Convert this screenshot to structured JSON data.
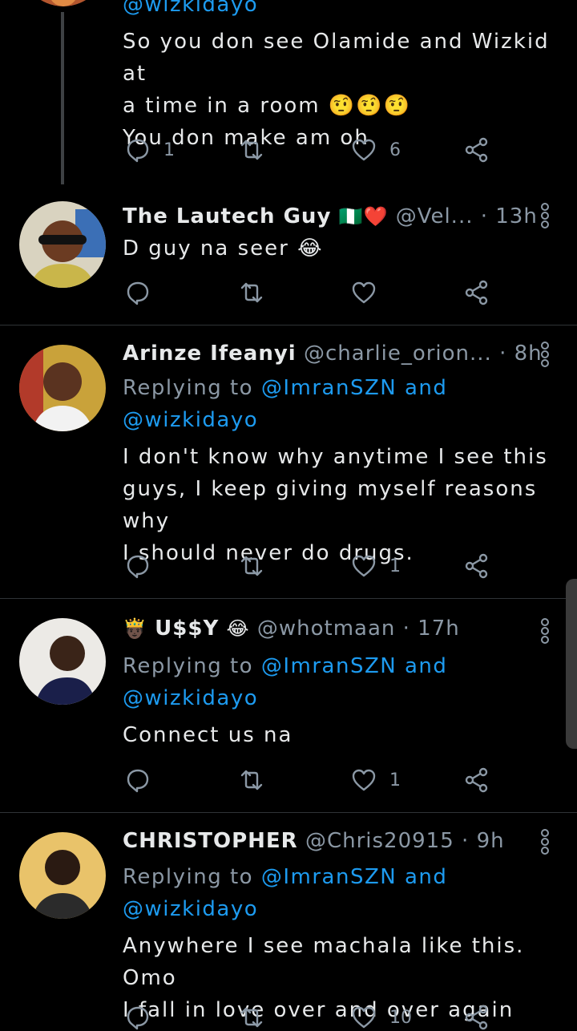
{
  "tweets": [
    {
      "mention_top": "@wizkidayo",
      "text_lines": [
        "So you don see Olamide and Wizkid at",
        "a time in a room 🤨🤨🤨",
        "You don make am oh"
      ],
      "reply_count": "1",
      "like_count": "6"
    },
    {
      "name": "The Lautech Guy",
      "name_emoji": "🇳🇬❤️",
      "handle": "@Vel...",
      "time": "· 13h",
      "text_lines": [
        "D guy na seer 😂"
      ]
    },
    {
      "name": "Arinze Ifeanyi",
      "handle": "@charlie_orion...",
      "time": "· 8h",
      "replying_prefix": "Replying to",
      "mention1": "@ImranSZN and",
      "mention2": "@wizkidayo",
      "text_lines": [
        "I don't know why anytime I see this",
        "guys, I keep giving myself reasons why",
        "I should never do drugs."
      ],
      "like_count": "1"
    },
    {
      "name_prefix_emoji": "🤴🏿",
      "name": "U$$Y",
      "name_emoji": "😂",
      "handle": "@whotmaan",
      "time": "· 17h",
      "replying_prefix": "Replying to",
      "mention1": "@ImranSZN and",
      "mention2": "@wizkidayo",
      "text_lines": [
        "Connect us na"
      ],
      "like_count": "1"
    },
    {
      "name": "CHRISTOPHER",
      "handle": "@Chris20915",
      "time": "· 9h",
      "replying_prefix": "Replying to",
      "mention1": "@ImranSZN and",
      "mention2": "@wizkidayo",
      "text_lines": [
        "Anywhere I see machala like this. Omo",
        "I fall in love over and over again"
      ],
      "like_count": "10"
    }
  ],
  "icons": {
    "reply": "reply-icon",
    "retweet": "retweet-icon",
    "like": "heart-icon",
    "share": "share-icon",
    "more": "more-options-icon"
  },
  "colors": {
    "background": "#000000",
    "accent": "#1d9bf0",
    "muted": "#8b98a5"
  }
}
